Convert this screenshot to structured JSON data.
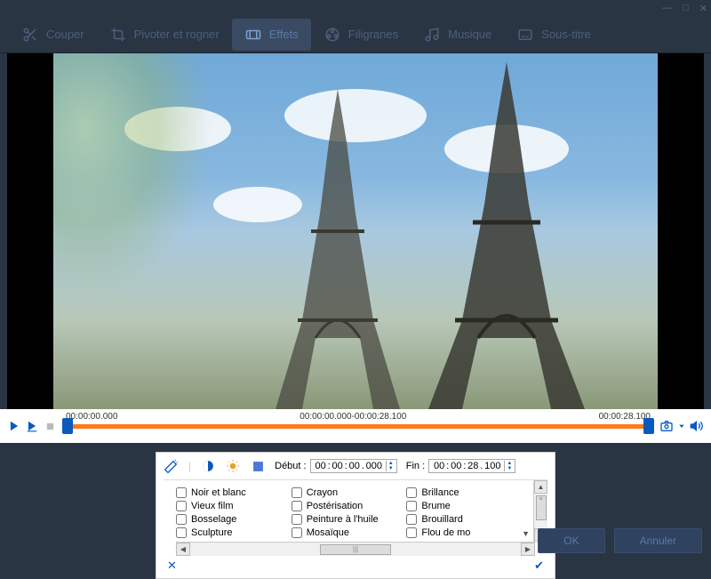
{
  "titlebar": {
    "min": "—",
    "max": "□",
    "close": "✕"
  },
  "toolbar": {
    "cut": "Couper",
    "rotate": "Pivoter et rogner",
    "effects": "Effets",
    "watermark": "Filigranes",
    "music": "Musique",
    "subtitle": "Sous-titre"
  },
  "timeline": {
    "start": "00:00:00.000",
    "range": "00:00:00.000-00:00:28.100",
    "end": "00:00:28.100"
  },
  "panel": {
    "start_label": "Début :",
    "end_label": "Fin :",
    "start_h": "00",
    "start_m": "00",
    "start_s": "00",
    "start_ms": "000",
    "end_h": "00",
    "end_m": "00",
    "end_s": "28",
    "end_ms": "100"
  },
  "effects": {
    "col1": [
      "Noir et blanc",
      "Vieux film",
      "Bosselage",
      "Sculpture"
    ],
    "col2": [
      "Crayon",
      "Postérisation",
      "Peinture à l'huile",
      "Mosaïque"
    ],
    "col3": [
      "Brillance",
      "Brume",
      "Brouillard",
      "Flou de mo"
    ]
  },
  "buttons": {
    "ok": "OK",
    "cancel": "Annuler"
  }
}
